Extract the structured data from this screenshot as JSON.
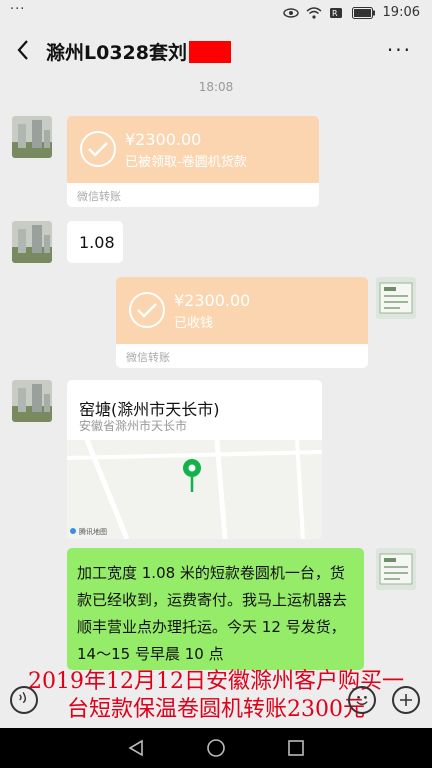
{
  "status_bar": {
    "menu_dots": "···",
    "time": "19:06"
  },
  "header": {
    "title": "滁州L0328套刘",
    "more": "···"
  },
  "timestamp": "18:08",
  "messages": {
    "transfer_received": {
      "amount": "¥2300.00",
      "status": "已被领取-卷圆机货款",
      "footer": "微信转账"
    },
    "text_1": "1.08",
    "transfer_sent": {
      "amount": "¥2300.00",
      "status": "已收钱",
      "footer": "微信转账"
    },
    "location": {
      "name": "窑塘(滁州市天长市)",
      "address": "安徽省滁州市天长市",
      "map_source": "腾讯地图"
    },
    "text_2": "加工宽度 1.08 米的短款卷圆机一台，货款已经收到，运费寄付。我马上运机器去顺丰营业点办理托运。今天 12 号发货，14～15 号早晨 10 点"
  },
  "caption": {
    "line1": "2019年12月12日安徽滁州客户购买一",
    "line2": "台短款保温卷圆机转账2300元"
  },
  "colors": {
    "background": "#ededed",
    "transfer_orange": "#fbd5b0",
    "my_bubble_green": "#95ec69",
    "caption_red": "#e0001a",
    "redaction": "#ff0000"
  }
}
